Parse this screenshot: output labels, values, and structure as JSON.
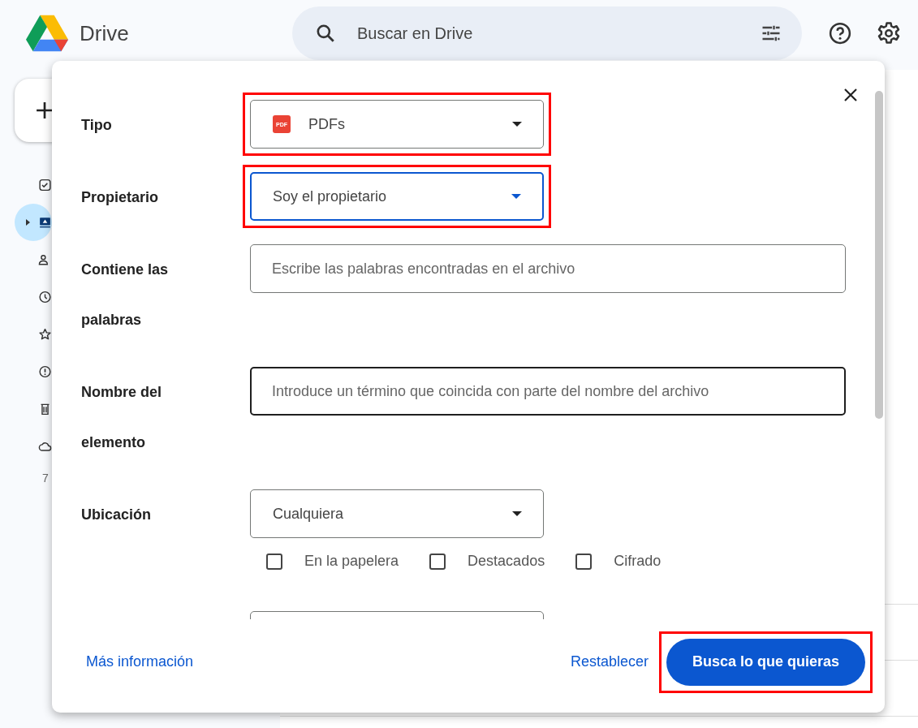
{
  "header": {
    "app_name": "Drive",
    "search": {
      "placeholder": "Buscar en Drive"
    }
  },
  "sidebar": {
    "items": [
      {
        "selected": false
      },
      {
        "selected": true
      },
      {
        "selected": false
      },
      {
        "selected": false
      },
      {
        "selected": false
      },
      {
        "selected": false
      },
      {
        "selected": false
      },
      {
        "selected": false
      }
    ],
    "storage_text": "7"
  },
  "dialog": {
    "fields": [
      {
        "kind": "select",
        "label": "Tipo",
        "value": "PDFs",
        "file_badge": "PDF",
        "focused": false,
        "highlighted": true
      },
      {
        "kind": "select",
        "label": "Propietario",
        "value": "Soy el propietario",
        "focused": true,
        "highlighted": true
      },
      {
        "kind": "text",
        "label": "Contiene las palabras",
        "placeholder": "Escribe las palabras encontradas en el archivo",
        "focused": false,
        "highlighted": false
      },
      {
        "kind": "text",
        "label": "Nombre del elemento",
        "placeholder": "Introduce un término que coincida con parte del nombre del archivo",
        "focused": true,
        "highlighted": false
      },
      {
        "kind": "select",
        "label": "Ubicación",
        "value": "Cualquiera",
        "focused": false,
        "highlighted": false,
        "options": [
          {
            "label": "En la papelera",
            "checked": false
          },
          {
            "label": "Destacados",
            "checked": false
          },
          {
            "label": "Cifrado",
            "checked": false
          }
        ]
      }
    ],
    "footer": {
      "link": "Más información",
      "reset": "Restablecer",
      "submit": {
        "label": "Busca lo que quieras",
        "highlighted": true
      }
    }
  }
}
